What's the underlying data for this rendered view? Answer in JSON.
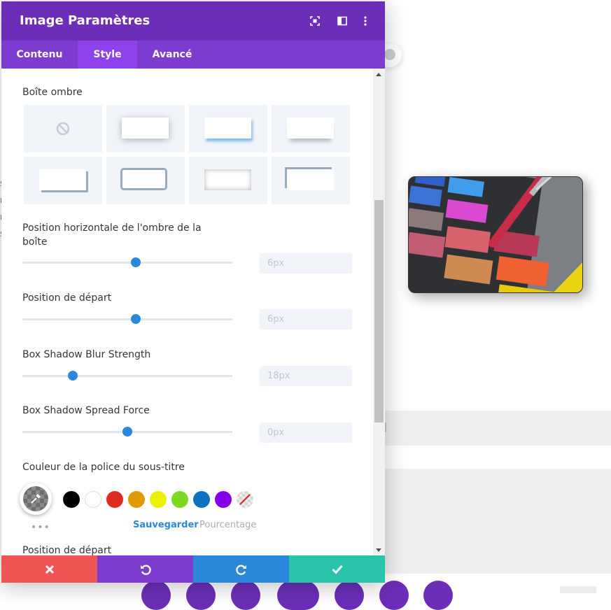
{
  "modal": {
    "title": "Image Paramètres",
    "tabs": [
      {
        "label": "Contenu"
      },
      {
        "label": "Style"
      },
      {
        "label": "Avancé"
      }
    ],
    "active_tab": "Style"
  },
  "box_shadow": {
    "label": "Boîte ombre"
  },
  "settings": [
    {
      "label": "Position horizontale de l'ombre de la boîte",
      "value": "6px",
      "position": 0.54
    },
    {
      "label": "Position de départ",
      "value": "6px",
      "position": 0.54
    },
    {
      "label": "Box Shadow Blur Strength",
      "value": "18px",
      "position": 0.24
    },
    {
      "label": "Box Shadow Spread Force",
      "value": "0px",
      "position": 0.5
    }
  ],
  "color": {
    "label": "Couleur de la police du sous-titre",
    "swatches": [
      "#000000",
      "#ffffff",
      "#e02b20",
      "#e09900",
      "#edf000",
      "#7cda24",
      "#0c71c3",
      "#8300e9"
    ],
    "save_label": "Sauvegarder",
    "percent_label": "Pourcentage",
    "more_label": "•••"
  },
  "next_section_label": "Position de départ",
  "footer": {
    "colors": {
      "cancel": "#ef5555",
      "undo": "#7e3bd0",
      "redo": "#2b87da",
      "save": "#29c4a9"
    }
  },
  "accent_color": "#6c2eb9",
  "edge_letters": [
    "s",
    "n",
    "n",
    "s"
  ]
}
